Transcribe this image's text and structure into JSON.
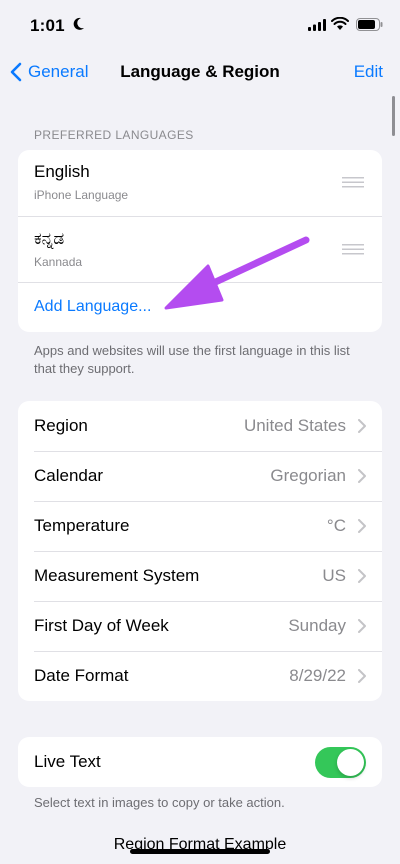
{
  "status_bar": {
    "time": "1:01"
  },
  "nav": {
    "back_label": "General",
    "title": "Language & Region",
    "edit_label": "Edit"
  },
  "preferred_languages": {
    "header": "PREFERRED LANGUAGES",
    "languages": [
      {
        "name": "English",
        "subtitle": "iPhone Language"
      },
      {
        "name": "ಕನ್ನಡ",
        "subtitle": "Kannada"
      }
    ],
    "add_label": "Add Language...",
    "footer": "Apps and websites will use the first language in this list that they support."
  },
  "region_settings": [
    {
      "label": "Region",
      "value": "United States"
    },
    {
      "label": "Calendar",
      "value": "Gregorian"
    },
    {
      "label": "Temperature",
      "value": "°C"
    },
    {
      "label": "Measurement System",
      "value": "US"
    },
    {
      "label": "First Day of Week",
      "value": "Sunday"
    },
    {
      "label": "Date Format",
      "value": "8/29/22"
    }
  ],
  "live_text": {
    "label": "Live Text",
    "enabled": true,
    "footer": "Select text in images to copy or take action."
  },
  "region_format_example": {
    "heading": "Region Format Example"
  },
  "colors": {
    "accent": "#0a7aff",
    "toggle_on": "#34c759",
    "annotation_arrow": "#b44cf0",
    "background": "#f2f2f7"
  }
}
